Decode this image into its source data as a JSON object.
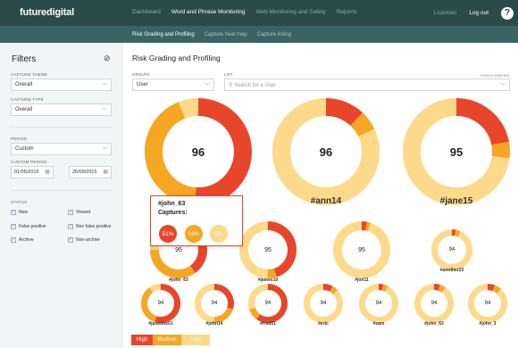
{
  "app": {
    "logo": "futuredigital"
  },
  "topnav": {
    "items": [
      "Dashboard",
      "Word and Phrase Monitoring",
      "Web Monitoring and Safety",
      "Reports"
    ],
    "active": 1
  },
  "topright": {
    "licences": "Licences",
    "logout": "Log out",
    "help": "?"
  },
  "subnav": {
    "items": [
      "Risk Grading and Profiling",
      "Capture heat map",
      "Capture listing"
    ],
    "active": 0
  },
  "filters": {
    "title": "Filters",
    "capture_theme_label": "CAPTURE THEME",
    "capture_theme_value": "Overall",
    "capture_type_label": "CAPTURE TYPE",
    "capture_type_value": "Overall",
    "period_label": "PERIOD",
    "period_value": "Custom",
    "custom_period_label": "CUSTOM PERIOD",
    "date_from": "01/05/2015",
    "date_to": "26/09/2015",
    "status_label": "STATUS",
    "status": [
      {
        "label": "New",
        "checked": true
      },
      {
        "label": "Viewed",
        "checked": true
      },
      {
        "label": "False positive",
        "checked": true
      },
      {
        "label": "Non false positive",
        "checked": true
      },
      {
        "label": "Archive",
        "checked": true
      },
      {
        "label": "Non-archive",
        "checked": true
      }
    ]
  },
  "main": {
    "title": "Risk Grading and Profiling",
    "groups_label": "GROUPS",
    "groups_value": "User",
    "list_label": "LIST",
    "search_placeholder": "Search for a User",
    "selected_count": "0 items selected"
  },
  "colors": {
    "high": "#e8462a",
    "medium": "#f5a623",
    "low": "#fdd98a"
  },
  "users": [
    {
      "name": "#john_63",
      "score": "96",
      "high": 0.51,
      "medium": 0.43,
      "low": 0.06
    },
    {
      "name": "#ann14",
      "score": "96",
      "high": 0.12,
      "medium": 0.06,
      "low": 0.82
    },
    {
      "name": "#jane15",
      "score": "95",
      "high": 0.22,
      "medium": 0.05,
      "low": 0.73
    },
    {
      "name": "#john_63",
      "score": "95",
      "high": 0.4,
      "medium": 0.35,
      "low": 0.25
    },
    {
      "name": "#james10",
      "score": "95",
      "high": 0.45,
      "medium": 0.05,
      "low": 0.5
    },
    {
      "name": "#jon11",
      "score": "95",
      "high": 0.03,
      "medium": 0.02,
      "low": 0.95
    },
    {
      "name": "#another23",
      "score": "94",
      "high": 0.03,
      "medium": 0.04,
      "low": 0.93
    },
    {
      "name": "#janedoe01",
      "score": "94",
      "high": 0.55,
      "medium": 0.35,
      "low": 0.1
    },
    {
      "name": "#john14",
      "score": "94",
      "high": 0.3,
      "medium": 0.2,
      "low": 0.5
    },
    {
      "name": "#fred01",
      "score": "94",
      "high": 0.6,
      "medium": 0.1,
      "low": 0.3
    },
    {
      "name": "#eric",
      "score": "94",
      "high": 0.08,
      "medium": 0.05,
      "low": 0.87
    },
    {
      "name": "#sam",
      "score": "94",
      "high": 0.04,
      "medium": 0.04,
      "low": 0.92
    },
    {
      "name": "#john_63",
      "score": "94",
      "high": 0.05,
      "medium": 0.05,
      "low": 0.9
    },
    {
      "name": "#john_3",
      "score": "94",
      "high": 0.06,
      "medium": 0.06,
      "low": 0.88
    }
  ],
  "tooltip": {
    "name": "#john_63",
    "captures_label": "Captures:",
    "high": "51%",
    "medium": "43%",
    "low": "6%"
  },
  "legend": {
    "high": "High",
    "medium": "Medium",
    "low": "Low"
  }
}
